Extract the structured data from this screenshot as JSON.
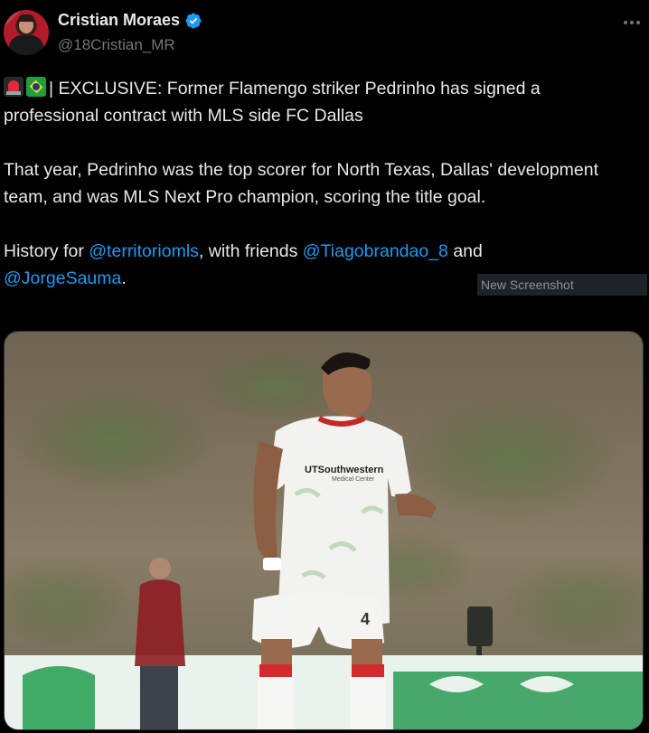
{
  "author": {
    "display_name": "Cristian Moraes",
    "handle": "@18Cristian_MR",
    "avatar_icon": "profile-avatar",
    "verified_icon": "verified-badge-icon"
  },
  "tweet": {
    "line1_text": "| EXCLUSIVE: Former Flamengo striker Pedrinho has signed a professional contract with MLS side FC Dallas",
    "para2": "That year, Pedrinho was the top scorer for North Texas, Dallas' development team, and was MLS Next Pro champion, scoring the title goal.",
    "para3_prefix": "History for ",
    "mention1": "@territoriomls",
    "para3_mid": ", with friends ",
    "mention2": "@Tiagobrandao_8",
    "para3_and": " and",
    "mention3": "@JorgeSauma",
    "para3_suffix": "."
  },
  "overlay": {
    "watermark_text": "New Screenshot"
  },
  "media": {
    "jersey_sponsor": "UTSouthwestern",
    "jersey_sponsor_sub": "Medical Center",
    "shorts_number": "4"
  },
  "colors": {
    "background": "#000000",
    "text": "#e7e9ea",
    "muted": "#71767b",
    "link": "#1d9bf0",
    "verified": "#1d9bf0"
  }
}
